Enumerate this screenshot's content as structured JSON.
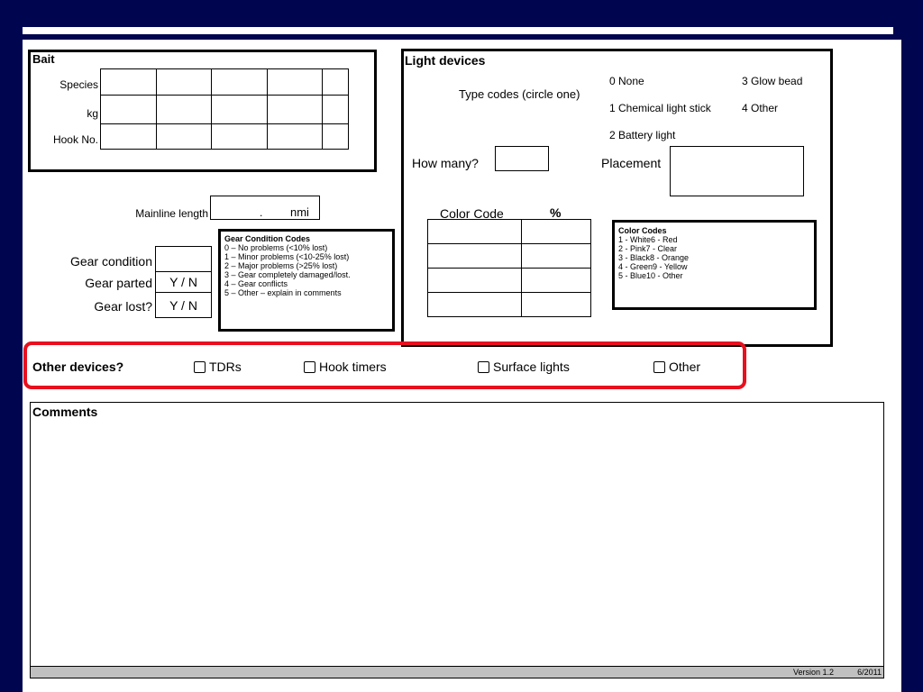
{
  "bait": {
    "title": "Bait",
    "rows": [
      "Species",
      "kg",
      "Hook No."
    ]
  },
  "mainline": {
    "label": "Mainline length",
    "dot": ".",
    "unit": "nmi"
  },
  "gear": {
    "condition_label": "Gear condition",
    "parted_label": "Gear parted",
    "parted_value": "Y / N",
    "lost_label": "Gear lost?",
    "lost_value": "Y / N",
    "codes_title": "Gear Condition Codes",
    "codes": [
      "0 – No problems  (<10% lost)",
      "1 – Minor problems  (<10-25% lost)",
      "2 – Major problems  (>25% lost)",
      "3 – Gear completely damaged/lost.",
      "4 – Gear conflicts",
      "5 – Other – explain in comments"
    ]
  },
  "light": {
    "title": "Light devices",
    "type_codes_label": "Type codes (circle one)",
    "type_codes": [
      "0 None",
      "1 Chemical light stick",
      "2 Battery light",
      "3 Glow bead",
      "4 Other"
    ],
    "how_many_label": "How many?",
    "placement_label": "Placement",
    "color_code_header": "Color Code",
    "percent_header": "%",
    "color_codes_title": "Color Codes",
    "color_codes": [
      "1 - White6 - Red",
      "2 - Pink7 - Clear",
      "3 - Black8 - Orange",
      "4 - Green9 -   Yellow",
      "5 - Blue10 - Other"
    ]
  },
  "other_devices": {
    "label": "Other devices?",
    "options": [
      "TDRs",
      "Hook timers",
      "Surface lights",
      "Other"
    ],
    "highlight_color": "#e8101e"
  },
  "comments": {
    "label": "Comments"
  },
  "footer": {
    "version": "Version 1.2",
    "date": "6/2011"
  }
}
